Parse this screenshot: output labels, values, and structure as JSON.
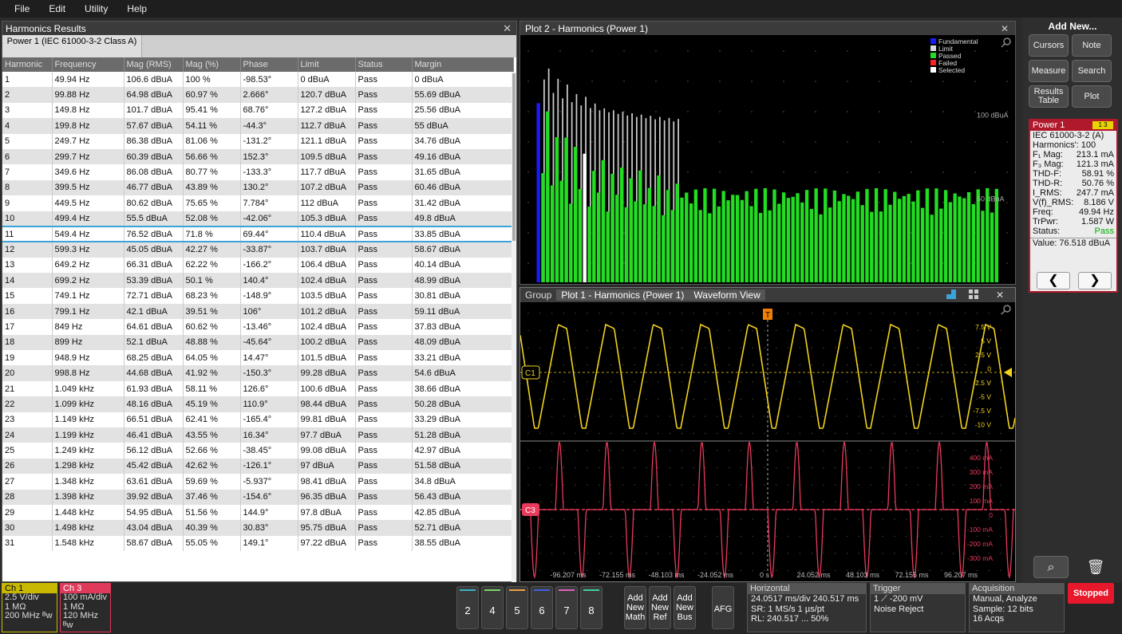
{
  "menu": [
    "File",
    "Edit",
    "Utility",
    "Help"
  ],
  "results": {
    "title": "Harmonics Results",
    "close": "✕",
    "tab": "Power 1 (IEC 61000-3-2  Class A)",
    "columns": [
      "Harmonic",
      "Frequency",
      "Mag (RMS)",
      "Mag (%)",
      "Phase",
      "Limit",
      "Status",
      "Margin"
    ],
    "rows": [
      [
        "1",
        "49.94 Hz",
        "106.6 dBuA",
        "100 %",
        "-98.53°",
        "0 dBuA",
        "Pass",
        "0 dBuA"
      ],
      [
        "2",
        "99.88 Hz",
        "64.98 dBuA",
        "60.97 %",
        "2.666°",
        "120.7 dBuA",
        "Pass",
        "55.69 dBuA"
      ],
      [
        "3",
        "149.8 Hz",
        "101.7 dBuA",
        "95.41 %",
        "68.76°",
        "127.2 dBuA",
        "Pass",
        "25.56 dBuA"
      ],
      [
        "4",
        "199.8 Hz",
        "57.67 dBuA",
        "54.11 %",
        "-44.3°",
        "112.7 dBuA",
        "Pass",
        "55 dBuA"
      ],
      [
        "5",
        "249.7 Hz",
        "86.38 dBuA",
        "81.06 %",
        "-131.2°",
        "121.1 dBuA",
        "Pass",
        "34.76 dBuA"
      ],
      [
        "6",
        "299.7 Hz",
        "60.39 dBuA",
        "56.66 %",
        "152.3°",
        "109.5 dBuA",
        "Pass",
        "49.16 dBuA"
      ],
      [
        "7",
        "349.6 Hz",
        "86.08 dBuA",
        "80.77 %",
        "-133.3°",
        "117.7 dBuA",
        "Pass",
        "31.65 dBuA"
      ],
      [
        "8",
        "399.5 Hz",
        "46.77 dBuA",
        "43.89 %",
        "130.2°",
        "107.2 dBuA",
        "Pass",
        "60.46 dBuA"
      ],
      [
        "9",
        "449.5 Hz",
        "80.62 dBuA",
        "75.65 %",
        "7.784°",
        "112 dBuA",
        "Pass",
        "31.42 dBuA"
      ],
      [
        "10",
        "499.4 Hz",
        "55.5 dBuA",
        "52.08 %",
        "-42.06°",
        "105.3 dBuA",
        "Pass",
        "49.8 dBuA"
      ],
      [
        "11",
        "549.4 Hz",
        "76.52 dBuA",
        "71.8 %",
        "69.44°",
        "110.4 dBuA",
        "Pass",
        "33.85 dBuA"
      ],
      [
        "12",
        "599.3 Hz",
        "45.05 dBuA",
        "42.27 %",
        "-33.87°",
        "103.7 dBuA",
        "Pass",
        "58.67 dBuA"
      ],
      [
        "13",
        "649.2 Hz",
        "66.31 dBuA",
        "62.22 %",
        "-166.2°",
        "106.4 dBuA",
        "Pass",
        "40.14 dBuA"
      ],
      [
        "14",
        "699.2 Hz",
        "53.39 dBuA",
        "50.1 %",
        "140.4°",
        "102.4 dBuA",
        "Pass",
        "48.99 dBuA"
      ],
      [
        "15",
        "749.1 Hz",
        "72.71 dBuA",
        "68.23 %",
        "-148.9°",
        "103.5 dBuA",
        "Pass",
        "30.81 dBuA"
      ],
      [
        "16",
        "799.1 Hz",
        "42.1 dBuA",
        "39.51 %",
        "106°",
        "101.2 dBuA",
        "Pass",
        "59.11 dBuA"
      ],
      [
        "17",
        "849 Hz",
        "64.61 dBuA",
        "60.62 %",
        "-13.46°",
        "102.4 dBuA",
        "Pass",
        "37.83 dBuA"
      ],
      [
        "18",
        "899 Hz",
        "52.1 dBuA",
        "48.88 %",
        "-45.64°",
        "100.2 dBuA",
        "Pass",
        "48.09 dBuA"
      ],
      [
        "19",
        "948.9 Hz",
        "68.25 dBuA",
        "64.05 %",
        "14.47°",
        "101.5 dBuA",
        "Pass",
        "33.21 dBuA"
      ],
      [
        "20",
        "998.8 Hz",
        "44.68 dBuA",
        "41.92 %",
        "-150.3°",
        "99.28 dBuA",
        "Pass",
        "54.6 dBuA"
      ],
      [
        "21",
        "1.049 kHz",
        "61.93 dBuA",
        "58.11 %",
        "126.6°",
        "100.6 dBuA",
        "Pass",
        "38.66 dBuA"
      ],
      [
        "22",
        "1.099 kHz",
        "48.16 dBuA",
        "45.19 %",
        "110.9°",
        "98.44 dBuA",
        "Pass",
        "50.28 dBuA"
      ],
      [
        "23",
        "1.149 kHz",
        "66.51 dBuA",
        "62.41 %",
        "-165.4°",
        "99.81 dBuA",
        "Pass",
        "33.29 dBuA"
      ],
      [
        "24",
        "1.199 kHz",
        "46.41 dBuA",
        "43.55 %",
        "16.34°",
        "97.7 dBuA",
        "Pass",
        "51.28 dBuA"
      ],
      [
        "25",
        "1.249 kHz",
        "56.12 dBuA",
        "52.66 %",
        "-38.45°",
        "99.08 dBuA",
        "Pass",
        "42.97 dBuA"
      ],
      [
        "26",
        "1.298 kHz",
        "45.42 dBuA",
        "42.62 %",
        "-126.1°",
        "97 dBuA",
        "Pass",
        "51.58 dBuA"
      ],
      [
        "27",
        "1.348 kHz",
        "63.61 dBuA",
        "59.69 %",
        "-5.937°",
        "98.41 dBuA",
        "Pass",
        "34.8 dBuA"
      ],
      [
        "28",
        "1.398 kHz",
        "39.92 dBuA",
        "37.46 %",
        "-154.6°",
        "96.35 dBuA",
        "Pass",
        "56.43 dBuA"
      ],
      [
        "29",
        "1.448 kHz",
        "54.95 dBuA",
        "51.56 %",
        "144.9°",
        "97.8 dBuA",
        "Pass",
        "42.85 dBuA"
      ],
      [
        "30",
        "1.498 kHz",
        "43.04 dBuA",
        "40.39 %",
        "30.83°",
        "95.75 dBuA",
        "Pass",
        "52.71 dBuA"
      ],
      [
        "31",
        "1.548 kHz",
        "58.67 dBuA",
        "55.05 %",
        "149.1°",
        "97.22 dBuA",
        "Pass",
        "38.55 dBuA"
      ]
    ],
    "selected_row": 11
  },
  "plot2": {
    "title": "Plot 2 - Harmonics (Power 1)",
    "close": "✕",
    "legend": [
      {
        "label": "Fundamental",
        "color": "#1a1aff"
      },
      {
        "label": "Limit",
        "color": "#dddddd"
      },
      {
        "label": "Passed",
        "color": "#22dd22"
      },
      {
        "label": "Failed",
        "color": "#ff2222"
      },
      {
        "label": "Selected",
        "color": "#ffffff"
      }
    ],
    "y_labels": [
      "100 dBuA",
      "50 dBuA"
    ]
  },
  "chart_data": {
    "type": "bar",
    "x": [
      1,
      2,
      3,
      4,
      5,
      6,
      7,
      8,
      9,
      10,
      11,
      12,
      13,
      14,
      15,
      16,
      17,
      18,
      19,
      20,
      21,
      22,
      23,
      24,
      25,
      26,
      27,
      28,
      29,
      30,
      31
    ],
    "series": [
      {
        "name": "Passed",
        "values": [
          106.6,
          64.98,
          101.7,
          57.67,
          86.38,
          60.39,
          86.08,
          46.77,
          80.62,
          55.5,
          76.52,
          45.05,
          66.31,
          53.39,
          72.71,
          42.1,
          64.61,
          52.1,
          68.25,
          44.68,
          61.93,
          48.16,
          66.51,
          46.41,
          56.12,
          45.42,
          63.61,
          39.92,
          54.95,
          43.04,
          58.67
        ]
      },
      {
        "name": "Limit",
        "values": [
          0,
          120.7,
          127.2,
          112.7,
          121.1,
          109.5,
          117.7,
          107.2,
          112,
          105.3,
          110.4,
          103.7,
          106.4,
          102.4,
          103.5,
          101.2,
          102.4,
          100.2,
          101.5,
          99.28,
          100.6,
          98.44,
          99.81,
          97.7,
          99.08,
          97,
          98.41,
          96.35,
          97.8,
          95.75,
          97.22
        ]
      }
    ],
    "ylabel": "",
    "y_tick_labels": [
      "100 dBuA",
      "50 dBuA"
    ],
    "ylim": [
      0,
      140
    ],
    "grid": true,
    "legend": "top-right"
  },
  "wave": {
    "tabs": [
      "Group",
      "Plot 1 - Harmonics (Power 1)",
      "Waveform View"
    ],
    "close": "✕",
    "ch1_label": "C1",
    "ch3_label": "C3",
    "trigger_label": "T",
    "ch1_scale": [
      "7.5 V",
      "5 V",
      "2.5 V",
      "0",
      "-2.5 V",
      "-5 V",
      "-7.5 V",
      "-10 V"
    ],
    "ch3_scale": [
      "400 mA",
      "300 mA",
      "200 mA",
      "100 mA",
      "0",
      "-100 mA",
      "-200 mA",
      "-300 mA"
    ],
    "x_ticks": [
      "-96.207 ms",
      "-72.155 ms",
      "-48.103 ms",
      "-24.052 ms",
      "0 s",
      "24.052 ms",
      "48.103 ms",
      "72.155 ms",
      "96.207 ms"
    ]
  },
  "side": {
    "add_new": "Add New...",
    "buttons": [
      "Cursors",
      "Note",
      "Measure",
      "Search",
      "Results Table",
      "Plot"
    ],
    "badge_title": "Power 1",
    "badge_flag": "1  3",
    "std": "IEC 61000-3-2 (A)",
    "harmonics": "Harmonics': 100",
    "meas": [
      [
        "F₁ Mag:",
        "213.1 mA"
      ],
      [
        "F₃ Mag:",
        "121.3 mA"
      ],
      [
        "THD-F:",
        "58.91 %"
      ],
      [
        "THD-R:",
        "50.76 %"
      ],
      [
        "I_RMS:",
        "247.7 mA"
      ],
      [
        "V(f)_RMS:",
        "8.186 V"
      ],
      [
        "Freq:",
        "49.94 Hz"
      ],
      [
        "TrPwr:",
        "1.587 W"
      ],
      [
        "Status:",
        "Pass"
      ]
    ],
    "value": "Value: 76.518 dBuA",
    "prev": "❮",
    "next": "❯",
    "zoom_icon": "⌕",
    "trash_icon": "🗑"
  },
  "bottom": {
    "ch1": {
      "title": "Ch 1",
      "lines": [
        "2.5 V/div",
        "1 MΩ",
        "200 MHz ᴮw"
      ]
    },
    "ch3": {
      "title": "Ch 3",
      "lines": [
        "100 mA/div",
        "1 MΩ",
        "120 MHz ᴮw"
      ]
    },
    "channels": [
      "2",
      "4",
      "5",
      "6",
      "7",
      "8"
    ],
    "channel_colors": [
      "#3ab0c8",
      "#7bd66a",
      "#f0a040",
      "#4060e0",
      "#e060c0",
      "#40d0a0"
    ],
    "add_buttons": [
      "Add New Math",
      "Add New Ref",
      "Add New Bus"
    ],
    "afg": "AFG",
    "horizontal": {
      "title": "Horizontal",
      "lines": [
        "24.0517 ms/div 240.517 ms",
        "SR: 1 MS/s      1 µs/pt",
        "RL: 240.517 ...   50%"
      ]
    },
    "trigger": {
      "title": "Trigger",
      "lines": [
        "1   ⟋   -200 mV",
        "Noise Reject"
      ]
    },
    "acquisition": {
      "title": "Acquisition",
      "lines": [
        "Manual,   Analyze",
        "Sample: 12 bits",
        "16 Acqs"
      ]
    },
    "stopped": "Stopped"
  }
}
